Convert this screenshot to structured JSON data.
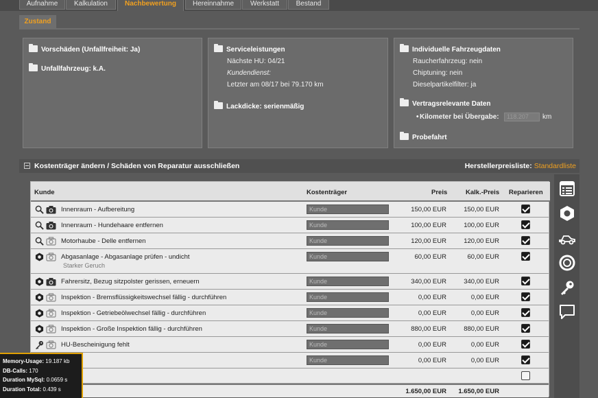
{
  "top_tabs": [
    {
      "label": "Aufnahme",
      "active": false
    },
    {
      "label": "Kalkulation",
      "active": false
    },
    {
      "label": "Nachbewertung",
      "active": true
    },
    {
      "label": "Hereinnahme",
      "active": false
    },
    {
      "label": "Werkstatt",
      "active": false
    },
    {
      "label": "Bestand",
      "active": false
    }
  ],
  "sub_tab": "Zustand",
  "panel1": {
    "heading1": "Vorschäden (Unfallfreiheit: Ja)",
    "heading2": "Unfallfahrzeug: k.A."
  },
  "panel2": {
    "heading": "Serviceleistungen",
    "line1": "Nächste HU: 04/21",
    "line2": "Kundendienst:",
    "line3": "Letzter am 08/17 bei 79.170 km",
    "heading2": "Lackdicke: serienmäßig"
  },
  "panel3": {
    "heading": "Individuelle Fahrzeugdaten",
    "line1": "Raucherfahrzeug: nein",
    "line2": "Chiptuning: nein",
    "line3": "Dieselpartikelfilter: ja",
    "heading2": "Vertragsrelevante Daten",
    "km_bullet": "•",
    "km_label": "Kilometer bei Übergabe:",
    "km_placeholder": "118.207",
    "km_unit": "km",
    "heading3": "Probefahrt"
  },
  "section": {
    "title": "Kostenträger ändern / Schäden von Reparatur ausschließen",
    "right_label": "Herstellerpreisliste:",
    "right_link": "Standardliste"
  },
  "table": {
    "headers": {
      "kunde": "Kunde",
      "kostentraeger": "Kostenträger",
      "preis": "Preis",
      "kalk": "Kalk.-Preis",
      "reparieren": "Reparieren"
    },
    "rows": [
      {
        "label": "Innenraum - Aufbereitung",
        "sub": "",
        "kunde": "Kunde",
        "preis": "150,00 EUR",
        "kalk": "150,00 EUR",
        "checked": true,
        "icon": "search-icon",
        "cam": "camera-icon"
      },
      {
        "label": "Innenraum - Hundehaare entfernen",
        "sub": "",
        "kunde": "Kunde",
        "preis": "100,00 EUR",
        "kalk": "100,00 EUR",
        "checked": true,
        "icon": "search-icon",
        "cam": "camera-icon"
      },
      {
        "label": "Motorhaube - Delle entfernen",
        "sub": "",
        "kunde": "Kunde",
        "preis": "120,00 EUR",
        "kalk": "120,00 EUR",
        "checked": true,
        "icon": "search-icon",
        "cam": "camera-outline-icon"
      },
      {
        "label": "Abgasanlage - Abgasanlage prüfen - undicht",
        "sub": "Starker Geruch",
        "kunde": "Kunde",
        "preis": "60,00 EUR",
        "kalk": "60,00 EUR",
        "checked": true,
        "icon": "hex-nut-icon",
        "cam": "camera-outline-icon"
      },
      {
        "label": "Fahrersitz, Bezug sitzpolster gerissen, erneuern",
        "sub": "",
        "kunde": "Kunde",
        "preis": "340,00 EUR",
        "kalk": "340,00 EUR",
        "checked": true,
        "icon": "hex-nut-icon",
        "cam": "camera-icon"
      },
      {
        "label": "Inspektion - Bremsflüssigkeitswechsel fällig - durchführen",
        "sub": "",
        "kunde": "Kunde",
        "preis": "0,00 EUR",
        "kalk": "0,00 EUR",
        "checked": true,
        "icon": "hex-nut-icon",
        "cam": "camera-outline-icon"
      },
      {
        "label": "Inspektion - Getriebeölwechsel fällig - durchführen",
        "sub": "",
        "kunde": "Kunde",
        "preis": "0,00 EUR",
        "kalk": "0,00 EUR",
        "checked": true,
        "icon": "hex-nut-icon",
        "cam": "camera-outline-icon"
      },
      {
        "label": "Inspektion - Große Inspektion fällig - durchführen",
        "sub": "",
        "kunde": "Kunde",
        "preis": "880,00 EUR",
        "kalk": "880,00 EUR",
        "checked": true,
        "icon": "hex-nut-icon",
        "cam": "camera-outline-icon"
      },
      {
        "label": "HU-Bescheinigung fehlt",
        "sub": "",
        "kunde": "Kunde",
        "preis": "0,00 EUR",
        "kalk": "0,00 EUR",
        "checked": true,
        "icon": "key-icon",
        "cam": "camera-outline-icon"
      },
      {
        "label": "ug fehlt",
        "sub": "",
        "kunde": "Kunde",
        "preis": "0,00 EUR",
        "kalk": "0,00 EUR",
        "checked": true,
        "icon": "",
        "cam": ""
      },
      {
        "label": "",
        "sub": "",
        "kunde": "",
        "preis": "",
        "kalk": "",
        "checked": false,
        "icon": "",
        "cam": ""
      }
    ],
    "total_preis": "1.650,00 EUR",
    "total_kalk": "1.650,00 EUR"
  },
  "toolbar": [
    "list-icon",
    "hex-nut-icon",
    "car-side-icon",
    "tire-icon",
    "key-icon",
    "chat-icon"
  ],
  "debug": [
    {
      "k": "Memory-Usage:",
      "v": "19.187 kb"
    },
    {
      "k": "DB-Calls:",
      "v": "170"
    },
    {
      "k": "Duration MySql:",
      "v": "0.0659 s"
    },
    {
      "k": "Duration Total:",
      "v": "0.439 s"
    }
  ],
  "colors": {
    "accent": "#f0a020",
    "panel": "#6b6b6b",
    "background": "#5a5a5a",
    "debug_border": "#e0a000"
  }
}
